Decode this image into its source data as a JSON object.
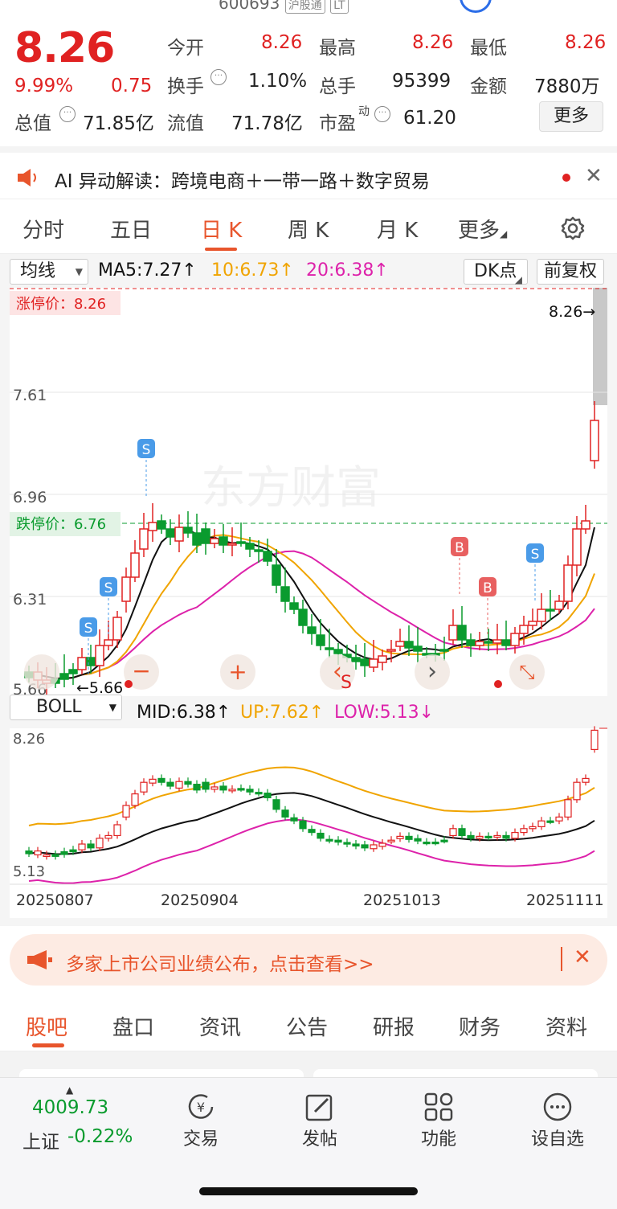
{
  "header": {
    "code": "600693",
    "tag1": "沪股通",
    "tag2": "LT"
  },
  "quote": {
    "price": "8.26",
    "pct": "9.99%",
    "change": "0.75",
    "open_label": "今开",
    "open": "8.26",
    "high_label": "最高",
    "high": "8.26",
    "low_label": "最低",
    "low": "8.26",
    "turnover_label": "换手",
    "turnover": "1.10%",
    "volume_label": "总手",
    "volume": "95399",
    "amount_label": "金额",
    "amount": "7880万",
    "mktcap_label": "总值",
    "mktcap": "71.85亿",
    "float_label": "流值",
    "float": "71.78亿",
    "pe_label": "市盈",
    "pe_sup": "动",
    "pe": "61.20",
    "more": "更多"
  },
  "ai": {
    "text": "AI 异动解读：跨境电商＋一带一路＋数字贸易"
  },
  "tabs": [
    "分时",
    "五日",
    "日 K",
    "周 K",
    "月 K",
    "更多"
  ],
  "kline": {
    "ma_select": "均线",
    "ma5": "MA5:7.27↑",
    "ma10": "10:6.73↑",
    "ma20": "20:6.38↑",
    "dk": "DK点",
    "adj": "前复权",
    "y_ticks": [
      "8.26",
      "7.61",
      "6.96",
      "6.31",
      "5.66"
    ],
    "limit_up": "涨停价：8.26",
    "limit_down": "跌停价：6.76",
    "last_marker": "8.26→",
    "low_marker": "←5.66",
    "watermark": "东方财富",
    "signals": [
      "S",
      "S",
      "S",
      "B",
      "B",
      "S"
    ],
    "signal_bottom": "S"
  },
  "boll": {
    "select": "BOLL",
    "mid": "MID:6.38↑",
    "up": "UP:7.62↑",
    "low": "LOW:5.13↓",
    "y_top": "8.26",
    "y_bottom": "5.13",
    "dates": [
      "20250807",
      "20250904",
      "20251013",
      "20251111"
    ]
  },
  "colors": {
    "up": "#e02222",
    "down": "#0a9b2e",
    "ma5": "#111111",
    "ma10": "#f0a400",
    "ma20": "#dd22aa",
    "accent": "#e8552c"
  },
  "banner": {
    "text": "多家上市公司业绩公布，点击查看>>"
  },
  "bottom_tabs": [
    "股吧",
    "盘口",
    "资讯",
    "公告",
    "研报",
    "财务",
    "资料"
  ],
  "nav": {
    "index_value": "4009.73",
    "index_name": "上证",
    "index_change": "-0.22%",
    "trade": "交易",
    "post": "发帖",
    "func": "功能",
    "watch": "设自选"
  }
}
